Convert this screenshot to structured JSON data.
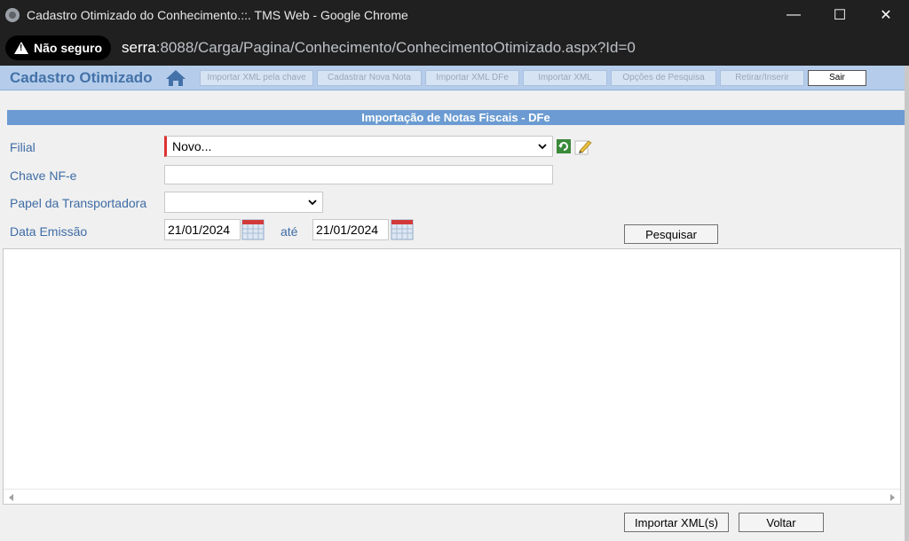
{
  "window": {
    "title": "Cadastro Otimizado do Conhecimento.::. TMS Web - Google Chrome",
    "minimize": "—",
    "maximize": "☐",
    "close": "✕"
  },
  "address": {
    "security_label": "Não seguro",
    "host": "serra",
    "path": ":8088/Carga/Pagina/Conhecimento/ConhecimentoOtimizado.aspx?Id=0"
  },
  "app": {
    "title": "Cadastro Otimizado",
    "toolbar": [
      {
        "label": "Importar XML pela chave",
        "enabled": false
      },
      {
        "label": "Cadastrar Nova Nota",
        "enabled": false
      },
      {
        "label": "Importar XML DFe",
        "enabled": false
      },
      {
        "label": "Importar XML",
        "enabled": false
      },
      {
        "label": "Opções de Pesquisa",
        "enabled": false
      },
      {
        "label": "Retirar/Inserir",
        "enabled": false
      },
      {
        "label": "Sair",
        "enabled": true
      }
    ]
  },
  "section": {
    "title": "Importação de Notas Fiscais - DFe"
  },
  "form": {
    "filial_label": "Filial",
    "filial_value": "Novo...",
    "chave_label": "Chave NF-e",
    "chave_value": "",
    "papel_label": "Papel da Transportadora",
    "papel_value": "",
    "data_label": "Data Emissão",
    "data_inicio": "21/01/2024",
    "ate_label": "até",
    "data_fim": "21/01/2024",
    "pesquisar_label": "Pesquisar"
  },
  "footer": {
    "importar_label": "Importar XML(s)",
    "voltar_label": "Voltar"
  },
  "colors": {
    "accent": "#4472a8",
    "header_bar": "#6b9bd2",
    "toolbar_bg": "#b5cdeb",
    "required": "#dd3333"
  }
}
